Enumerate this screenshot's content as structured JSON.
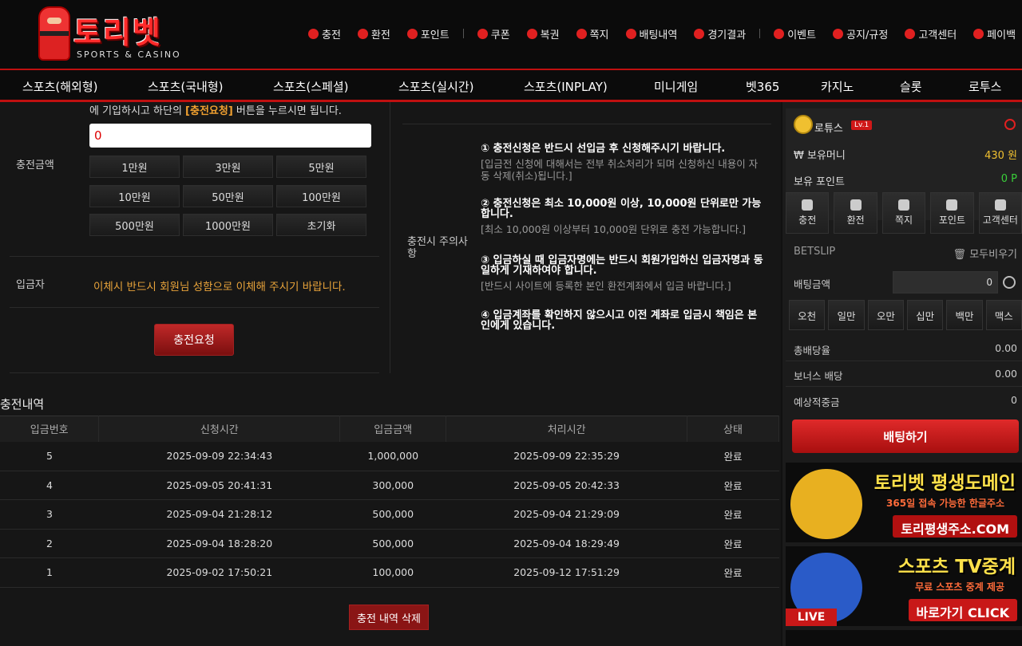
{
  "header": {
    "brand": "토리벳",
    "brand_sub": "SPORTS & CASINO",
    "topnav": [
      {
        "label": "충전",
        "icon": "charge-icon"
      },
      {
        "label": "환전",
        "icon": "money-bag-icon"
      },
      {
        "label": "포인트",
        "icon": "point-icon"
      },
      {
        "label": "쿠폰",
        "icon": "coupon-icon"
      },
      {
        "label": "복권",
        "icon": "lottery-icon"
      },
      {
        "label": "쪽지",
        "icon": "mail-icon"
      },
      {
        "label": "배팅내역",
        "icon": "history-icon"
      },
      {
        "label": "경기결과",
        "icon": "result-icon"
      },
      {
        "label": "이벤트",
        "icon": "gift-icon"
      },
      {
        "label": "공지/규정",
        "icon": "megaphone-icon"
      },
      {
        "label": "고객센터",
        "icon": "support-icon"
      },
      {
        "label": "페이백",
        "icon": "payback-icon"
      }
    ],
    "mainnav": [
      "스포츠(해외형)",
      "스포츠(국내형)",
      "스포츠(스페셜)",
      "스포츠(실시간)",
      "스포츠(INPLAY)",
      "미니게임",
      "벳365",
      "카지노",
      "슬롯",
      "로투스"
    ]
  },
  "deposit": {
    "notice_pre": "에 기입하시고 하단의 ",
    "notice_btn": "[충전요청]",
    "notice_post": " 버튼을 누르시면 됩니다.",
    "amount_label": "충전금액",
    "amount_value": "0",
    "quick": [
      "1만원",
      "3만원",
      "5만원",
      "10만원",
      "50만원",
      "100만원",
      "500만원",
      "1000만원",
      "초기화"
    ],
    "depositor_label": "입금자",
    "depositor_warning": "이체시 반드시 회원님 성함으로 이체해 주시기 바랍니다.",
    "request_button": "충전요청"
  },
  "caution": {
    "label": "충전시 주의사항",
    "rules": [
      {
        "title": "① 충전신청은 반드시 선입금 후 신청해주시기 바랍니다.",
        "desc": "[입금전 신청에 대해서는 전부 취소처리가 되며 신청하신 내용이 자동 삭제(취소)됩니다.]"
      },
      {
        "title": "② 충전신청은 최소 10,000원 이상, 10,000원 단위로만 가능합니다.",
        "desc": "[최소 10,000원 이상부터 10,000원 단위로 충전 가능합니다.]"
      },
      {
        "title": "③ 입금하실 때 입금자명에는 반드시 회원가입하신 입금자명과 동일하게 기재하여야 합니다.",
        "desc": "[반드시 사이트에 등록한 본인 환전계좌에서 입금 바랍니다.]"
      },
      {
        "title": "④ 입금계좌를 확인하지 않으시고 이전 계좌로 입금시 책임은 본인에게 있습니다.",
        "desc": ""
      }
    ]
  },
  "history": {
    "title": "충전내역",
    "columns": [
      "입금번호",
      "신청시간",
      "입금금액",
      "처리시간",
      "상태"
    ],
    "rows": [
      [
        "5",
        "2025-09-09 22:34:43",
        "1,000,000",
        "2025-09-09 22:35:29",
        "완료"
      ],
      [
        "4",
        "2025-09-05 20:41:31",
        "300,000",
        "2025-09-05 20:42:33",
        "완료"
      ],
      [
        "3",
        "2025-09-04 21:28:12",
        "500,000",
        "2025-09-04 21:29:09",
        "완료"
      ],
      [
        "2",
        "2025-09-04 18:28:20",
        "500,000",
        "2025-09-04 18:29:49",
        "완료"
      ],
      [
        "1",
        "2025-09-02 17:50:21",
        "100,000",
        "2025-09-12 17:51:29",
        "완료"
      ]
    ],
    "delete_button": "충전 내역 삭제"
  },
  "user": {
    "name": "로튜스",
    "level": "Lv.1",
    "money_label": "₩ 보유머니",
    "money_value": "430 원",
    "point_label": "보유 포인트",
    "point_value": "0 P",
    "buttons": [
      "충전",
      "환전",
      "쪽지",
      "포인트",
      "고객센터"
    ]
  },
  "betslip": {
    "title": "BETSLIP",
    "clear": "모두비우기",
    "amount_label": "배팅금액",
    "amount_value": "0",
    "chips": [
      "오천",
      "일만",
      "오만",
      "십만",
      "백만",
      "맥스"
    ],
    "total_odds_label": "총배당율",
    "total_odds": "0.00",
    "bonus_label": "보너스 배당",
    "bonus": "0.00",
    "expected_label": "예상적중금",
    "expected": "0",
    "bet_button": "배팅하기"
  },
  "banners": [
    {
      "title": "토리벳 평생도메인",
      "sub": "365일 접속 가능한 한글주소",
      "cta": "토리평생주소.COM"
    },
    {
      "title": "스포츠 TV중계",
      "sub": "무료 스포츠 중계 제공",
      "cta": "바로가기 CLICK",
      "badge": "LIVE"
    }
  ],
  "colors": {
    "accent": "#c01010",
    "warning": "#e8a33a",
    "gold": "#f0c030"
  }
}
